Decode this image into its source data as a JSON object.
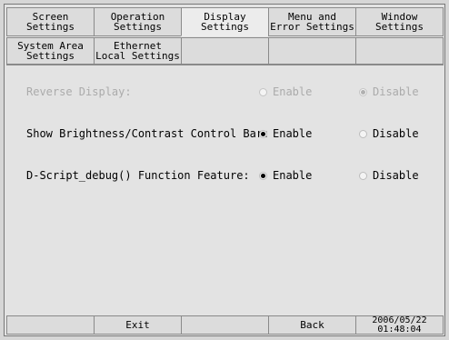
{
  "tabs_row1": [
    {
      "line1": "Screen",
      "line2": "Settings"
    },
    {
      "line1": "Operation",
      "line2": "Settings"
    },
    {
      "line1": "Display",
      "line2": "Settings"
    },
    {
      "line1": "Menu and",
      "line2": "Error Settings"
    },
    {
      "line1": "Window",
      "line2": "Settings"
    }
  ],
  "tabs_row2": [
    {
      "line1": "System Area",
      "line2": "Settings"
    },
    {
      "line1": "Ethernet",
      "line2": "Local Settings"
    }
  ],
  "settings": [
    {
      "label": "Reverse Display:",
      "enable": "Enable",
      "disable": "Disable",
      "selected": "disable",
      "disabled": true
    },
    {
      "label": "Show Brightness/Contrast Control Bar:",
      "enable": "Enable",
      "disable": "Disable",
      "selected": "enable",
      "disabled": false
    },
    {
      "label": "D-Script_debug() Function Feature:",
      "enable": "Enable",
      "disable": "Disable",
      "selected": "enable",
      "disabled": false
    }
  ],
  "bottom": {
    "exit_label": "Exit",
    "back_label": "Back",
    "date": "2006/05/22",
    "time": "01:48:04"
  }
}
